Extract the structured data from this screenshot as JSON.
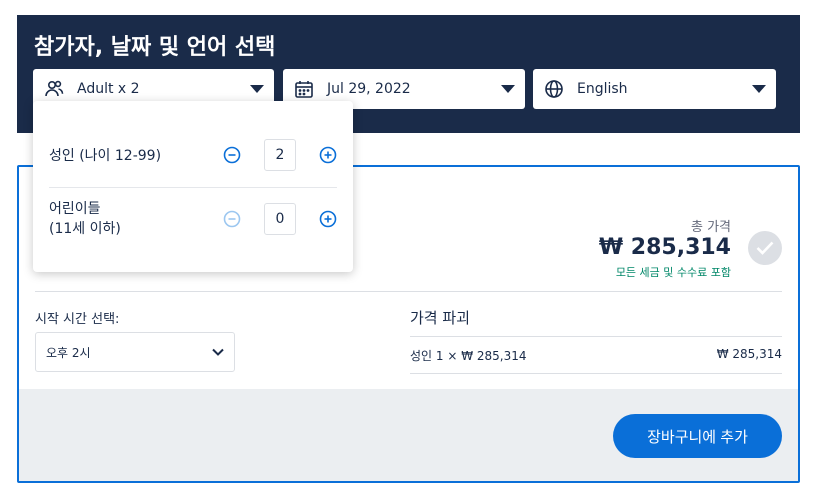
{
  "header": {
    "title": "참가자, 날짜 및 언어 선택",
    "participants_label": "Adult x 2",
    "date_label": "Jul 29, 2022",
    "language_label": "English"
  },
  "popup": {
    "adult": {
      "label": "성인",
      "age": "(나이 12-99)",
      "count": "2"
    },
    "child": {
      "label": "어린이들",
      "age": "(11세 이하)",
      "count": "0"
    }
  },
  "summary": {
    "total_label": "총 가격",
    "total_price": "₩ 285,314",
    "tax_note": "모든 세금 및 수수료 포함"
  },
  "time": {
    "label": "시작 시간 선택:",
    "selected": "오후 2시"
  },
  "breakdown": {
    "title": "가격 파괴",
    "line_left": "성인 1 × ₩ 285,314",
    "line_right": "₩ 285,314"
  },
  "cart_button": "장바구니에 추가",
  "colors": {
    "navy": "#1a2b49",
    "accent": "#0a6fd8",
    "green": "#008768"
  }
}
